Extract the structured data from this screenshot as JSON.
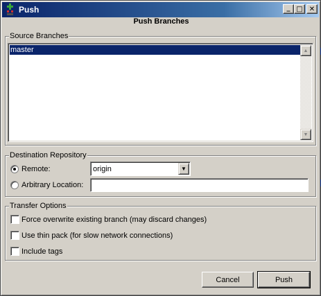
{
  "window": {
    "title": "Push",
    "buttons": {
      "minimize": "_",
      "maximize": "□",
      "close": "✕"
    }
  },
  "heading": "Push Branches",
  "source_branches": {
    "label": "Source Branches",
    "items": [
      "master"
    ],
    "selected": "master"
  },
  "destination": {
    "label": "Destination Repository",
    "remote_label": "Remote:",
    "remote_value": "origin",
    "arbitrary_label": "Arbitrary Location:",
    "arbitrary_value": "",
    "selected_option": "remote"
  },
  "transfer_options": {
    "label": "Transfer Options",
    "force_label": "Force overwrite existing branch (may discard changes)",
    "thin_pack_label": "Use thin pack (for slow network connections)",
    "tags_label": "Include tags"
  },
  "actions": {
    "cancel": "Cancel",
    "push": "Push"
  },
  "colors": {
    "titlebar_start": "#0a246a",
    "titlebar_end": "#a6caf0",
    "selection": "#0a246a",
    "face": "#d4d0c8"
  }
}
